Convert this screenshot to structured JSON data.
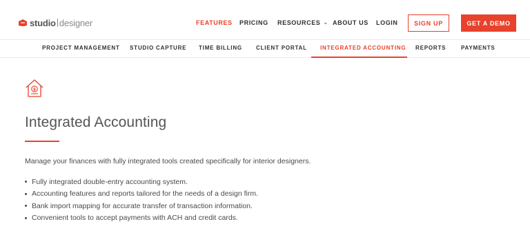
{
  "header": {
    "logo": {
      "studio": "studio",
      "designer": "designer"
    },
    "nav": [
      {
        "label": "FEATURES",
        "active": true
      },
      {
        "label": "PRICING"
      },
      {
        "label": "RESOURCES",
        "has_dropdown": true
      },
      {
        "label": "ABOUT US"
      },
      {
        "label": "LOGIN"
      }
    ],
    "signup_label": "SIGN UP",
    "demo_label": "GET A DEMO"
  },
  "subnav": {
    "items": [
      {
        "label": "PROJECT MANAGEMENT"
      },
      {
        "label": "STUDIO CAPTURE"
      },
      {
        "label": "TIME BILLING"
      },
      {
        "label": "CLIENT PORTAL"
      },
      {
        "label": "INTEGRATED ACCOUNTING",
        "active": true
      },
      {
        "label": "REPORTS"
      },
      {
        "label": "PAYMENTS"
      }
    ]
  },
  "main": {
    "icon": "house-dollar-icon",
    "title": "Integrated Accounting",
    "intro": "Manage your finances with fully integrated tools created specifically for interior designers.",
    "bullets": [
      "Fully integrated double-entry accounting system.",
      "Accounting features and reports tailored for the needs of a design firm.",
      "Bank import mapping for accurate transfer of transaction information.",
      "Convenient tools to accept payments with ACH and credit cards."
    ]
  },
  "colors": {
    "accent": "#e8412c",
    "text": "#4a4a4a",
    "heading": "#555555"
  }
}
